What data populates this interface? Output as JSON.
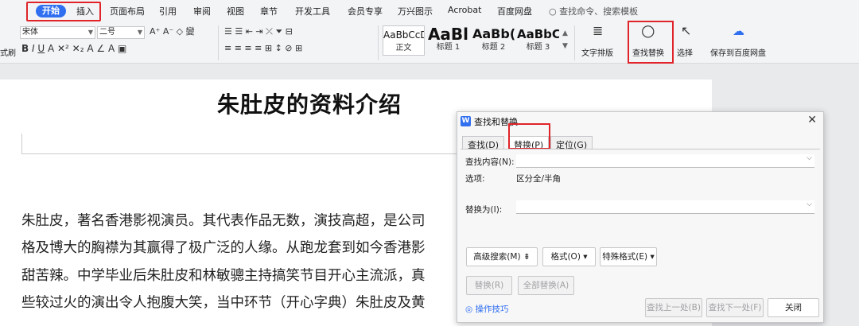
{
  "menu": {
    "items": [
      "开始",
      "插入",
      "页面布局",
      "引用",
      "审阅",
      "视图",
      "章节",
      "开发工具",
      "会员专享",
      "万兴图示",
      "Acrobat",
      "百度网盘"
    ],
    "search": "查找命令、搜索模板"
  },
  "ribbon": {
    "font": "宋体",
    "size": "二号",
    "styles": [
      {
        "preview": "AaBbCcDd",
        "name": "正文"
      },
      {
        "preview": "AaBl",
        "name": "标题 1"
      },
      {
        "preview": "AaBb(",
        "name": "标题 2"
      },
      {
        "preview": "AaBbC",
        "name": "标题 3"
      }
    ],
    "text_layout": "文字排版",
    "find_replace": "查找替换",
    "select": "选择",
    "save_baidu": "保存到百度网盘",
    "left_cut": "式刷"
  },
  "doc": {
    "title": "朱肚皮的资料介绍",
    "lines": [
      "朱肚皮，著名香港影视演员。其代表作品无数，演技高超，是公司",
      "格及博大的胸襟为其赢得了极广泛的人缘。从跑龙套到如今香港影",
      "甜苦辣。中学毕业后朱肚皮和林敏骢主持搞笑节目开心主流派，真",
      "些较过火的演出令人抱腹大笑，当中环节（开心字典）朱肚皮及黄"
    ]
  },
  "dialog": {
    "icon": "W",
    "title": "查找和替换",
    "tabs": [
      "查找(D)",
      "替换(P)",
      "定位(G)"
    ],
    "find_label": "查找内容(N):",
    "find_value": "",
    "options_label": "选项:",
    "options_value": "区分全/半角",
    "replace_label": "替换为(I):",
    "replace_value": "",
    "adv_search": "高级搜索(M)",
    "format": "格式(O)",
    "special": "特殊格式(E)",
    "replace_btn": "替换(R)",
    "replace_all": "全部替换(A)",
    "tips": "操作技巧",
    "find_prev": "查找上一处(B)",
    "find_next": "查找下一处(F)",
    "close": "关闭"
  }
}
